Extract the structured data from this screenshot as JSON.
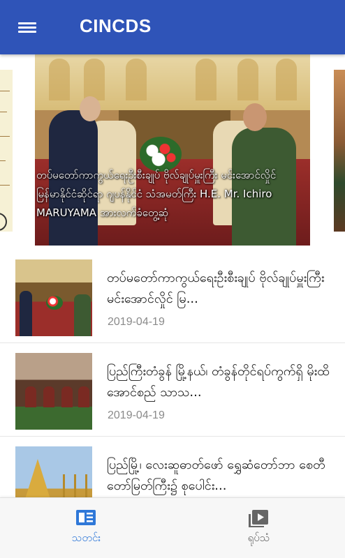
{
  "appbar": {
    "title": "CINCDS",
    "menu_icon": "hamburger-menu-icon",
    "background": "#2f54b8"
  },
  "carousel": {
    "caption": "တပ်မတော်ကာကွယ်ရေးဦးစီးချုပ် ဗိုလ်ချုပ်မှူးကြီး မင်းအောင်လှိုင် မြန်မာနိုင်ငံဆိုင်ရာ ဂျပန်နိုင်ငံ သံအမတ်ကြီး H.E. Mr. Ichiro MARUYAMA အားလက်ခံတွေ့ဆုံ"
  },
  "news": [
    {
      "title": "တပ်မတော်ကာကွယ်ရေးဦးစီးချုပ် ဗိုလ်ချုပ်မှူးကြီး မင်းအောင်လှိုင် မြ...",
      "date": "2019-04-19"
    },
    {
      "title": "ပြည်ကြီးတံခွန် မြို့နယ်၊ တံခွန်တိုင်ရပ်ကွက်ရှိ မိုးထိအောင်စည် သာသ...",
      "date": "2019-04-19"
    },
    {
      "title": "ပြည်မြို့၊ လေးဆူဓာတ်ဖော် ရွှေဆံတော်ဘာ စေတီတော်မြတ်ကြီး၌ စုပေါင်း...",
      "date": ""
    }
  ],
  "bottom_nav": {
    "news_label": "သတင်း",
    "video_label": "ရုပ်သံ",
    "news_icon": "news-icon",
    "video_icon": "video-library-icon",
    "active_color": "#2f78d8"
  }
}
